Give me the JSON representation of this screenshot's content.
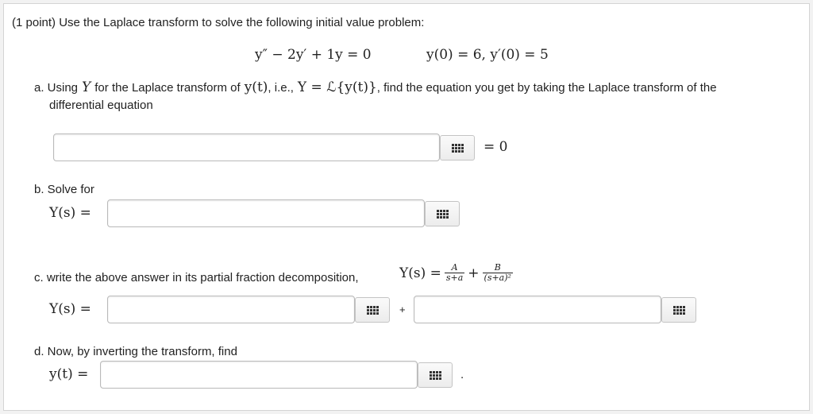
{
  "problem": {
    "intro": "(1 point) Use the Laplace transform to solve the following initial value problem:",
    "equation": "y″ − 2y′ + 1y = 0",
    "initial_conditions": "y(0) = 6, y′(0) = 5"
  },
  "part_a": {
    "prefix": "a. Using",
    "var_Y": "Y",
    "mid": "for the Laplace transform of",
    "y_of_t": "y(t)",
    "ie": ", i.e.,",
    "def": "Y = ℒ{y(t)}",
    "suffix": ", find the equation you get by taking the Laplace transform of the",
    "line2": "differential equation",
    "equals_zero": "= 0"
  },
  "part_b": {
    "label": "b. Solve for",
    "lhs": "Y(s) ="
  },
  "part_c": {
    "label": "c. write the above answer in its partial fraction decomposition,",
    "lhs_inline": "Y(s) =",
    "frac1_num": "A",
    "frac1_den": "s+a",
    "plus": "+",
    "frac2_num": "B",
    "frac2_den": "(s+a)²",
    "lhs": "Y(s) =",
    "between_plus": "+"
  },
  "part_d": {
    "label": "d. Now, by inverting the transform, find",
    "lhs": "y(t) =",
    "period": "."
  },
  "inputs": {
    "a_value": "",
    "b_value": "",
    "c1_value": "",
    "c2_value": "",
    "d_value": ""
  },
  "icons": {
    "keypad": "keypad-grid-icon"
  }
}
